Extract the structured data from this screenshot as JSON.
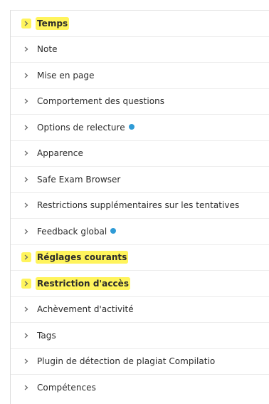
{
  "accent": {
    "highlight": "#fff45c",
    "info": "#2f9bd6"
  },
  "sections": [
    {
      "label": "Temps",
      "highlighted": true,
      "info": false
    },
    {
      "label": "Note",
      "highlighted": false,
      "info": false
    },
    {
      "label": "Mise en page",
      "highlighted": false,
      "info": false
    },
    {
      "label": "Comportement des questions",
      "highlighted": false,
      "info": false
    },
    {
      "label": "Options de relecture",
      "highlighted": false,
      "info": true
    },
    {
      "label": "Apparence",
      "highlighted": false,
      "info": false
    },
    {
      "label": "Safe Exam Browser",
      "highlighted": false,
      "info": false
    },
    {
      "label": "Restrictions supplémentaires sur les tentatives",
      "highlighted": false,
      "info": false
    },
    {
      "label": "Feedback global",
      "highlighted": false,
      "info": true
    },
    {
      "label": "Réglages courants",
      "highlighted": true,
      "info": false
    },
    {
      "label": "Restriction d'accès",
      "highlighted": true,
      "info": false
    },
    {
      "label": "Achèvement d'activité",
      "highlighted": false,
      "info": false
    },
    {
      "label": "Tags",
      "highlighted": false,
      "info": false
    },
    {
      "label": "Plugin de détection de plagiat Compilatio",
      "highlighted": false,
      "info": false
    },
    {
      "label": "Compétences",
      "highlighted": false,
      "info": false
    }
  ]
}
